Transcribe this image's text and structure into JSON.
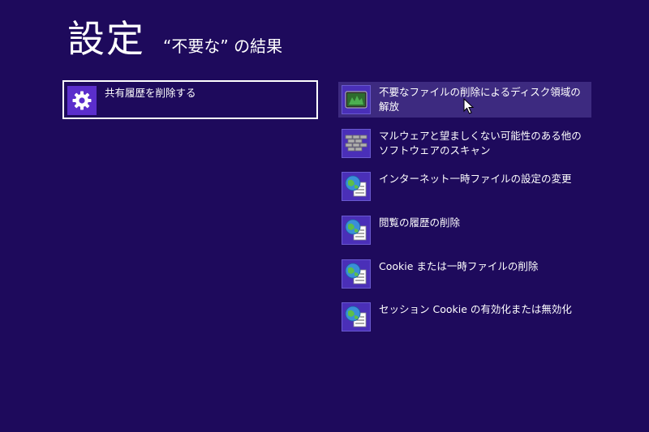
{
  "header": {
    "title": "設定",
    "query_text": "“不要な” の結果"
  },
  "left_results": [
    {
      "label": "共有履歴を削除する",
      "icon": "gear-icon"
    }
  ],
  "right_results": [
    {
      "label": "不要なファイルの削除によるディスク領域の解放",
      "icon": "disk-cleanup-icon"
    },
    {
      "label": "マルウェアと望ましくない可能性のある他のソフトウェアのスキャン",
      "icon": "firewall-icon"
    },
    {
      "label": "インターネット一時ファイルの設定の変更",
      "icon": "internet-options-icon"
    },
    {
      "label": "閲覧の履歴の削除",
      "icon": "internet-options-icon"
    },
    {
      "label": "Cookie または一時ファイルの削除",
      "icon": "internet-options-icon"
    },
    {
      "label": "セッション Cookie の有効化または無効化",
      "icon": "internet-options-icon"
    }
  ],
  "colors": {
    "background": "#1e0a5c",
    "hover": "#3d2a80",
    "tile": "#5b2ecc"
  }
}
